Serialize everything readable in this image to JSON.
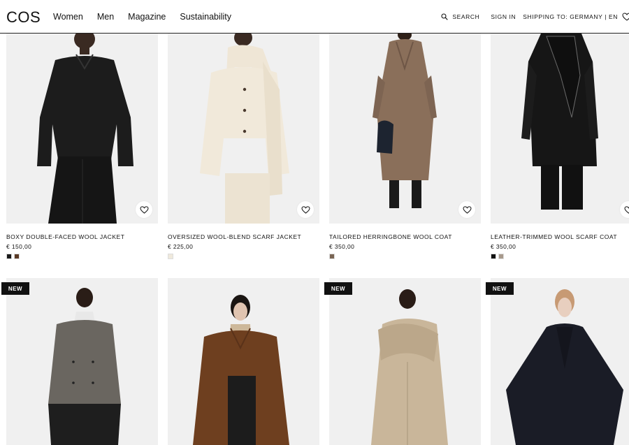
{
  "header": {
    "logo": "COS",
    "nav": [
      "Women",
      "Men",
      "Magazine",
      "Sustainability"
    ],
    "search_label": "SEARCH",
    "signin_label": "SIGN IN",
    "shipping_label": "SHIPPING TO: GERMANY | EN"
  },
  "products_row1": [
    {
      "name": "BOXY DOUBLE-FACED WOOL JACKET",
      "price": "€ 150,00",
      "swatches": [
        "#1a1a1a",
        "#5a3a26"
      ]
    },
    {
      "name": "OVERSIZED WOOL-BLEND SCARF JACKET",
      "price": "€ 225,00",
      "swatches": [
        "#efe9dc"
      ]
    },
    {
      "name": "TAILORED HERRINGBONE WOOL COAT",
      "price": "€ 350,00",
      "swatches": [
        "#7a6554"
      ]
    },
    {
      "name": "LEATHER-TRIMMED WOOL SCARF COAT",
      "price": "€ 350,00",
      "swatches": [
        "#111111",
        "#a89a8c"
      ]
    }
  ],
  "products_row2": [
    {
      "badge": "NEW"
    },
    {
      "badge": ""
    },
    {
      "badge": "NEW"
    },
    {
      "badge": "NEW"
    }
  ],
  "colors": {
    "photo_bg": "#f0f0f0",
    "badge_bg": "#111111",
    "text": "#111111"
  }
}
